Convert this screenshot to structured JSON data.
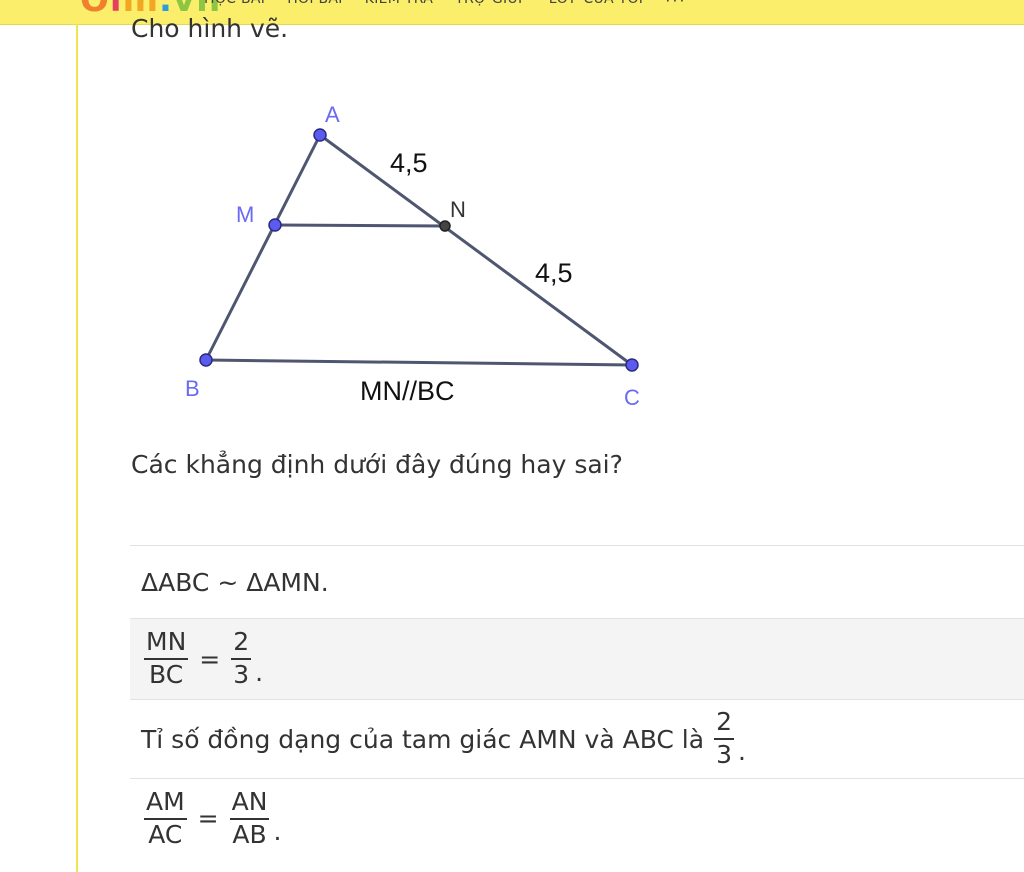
{
  "header": {
    "logo_letters": [
      "O",
      "l",
      "m",
      ".",
      "vn"
    ],
    "nav": [
      "HỌC BÀI",
      "HỎI BÀI",
      "KIỂM TRA",
      "TRỢ GIÚP",
      "LỚP CỦA TÔI"
    ],
    "more": "···"
  },
  "intro_text": "Cho hình vẽ.",
  "figure": {
    "points": {
      "A": "A",
      "B": "B",
      "C": "C",
      "M": "M",
      "N": "N"
    },
    "length_AN": "4,5",
    "length_NC": "4,5",
    "caption": "MN//BC"
  },
  "question_text": "Các khẳng định dưới đây đúng hay sai?",
  "statements": {
    "s1": "ΔABC ~ ΔAMN.",
    "s2": {
      "num_left": "MN",
      "den_left": "BC",
      "eq": "=",
      "num_right": "2",
      "den_right": "3",
      "end": "."
    },
    "s3": {
      "text": "Tỉ số đồng dạng của tam giác AMN và ABC là",
      "num": "2",
      "den": "3",
      "end": "."
    },
    "s4": {
      "num_left": "AM",
      "den_left": "AC",
      "eq": "=",
      "num_right": "AN",
      "den_right": "AB",
      "end": "."
    }
  },
  "colors": {
    "header_bg": "#fbee6b",
    "point_fill": "#5b5bf0",
    "point_label": "#6a6af2",
    "segment": "#4f5670"
  }
}
